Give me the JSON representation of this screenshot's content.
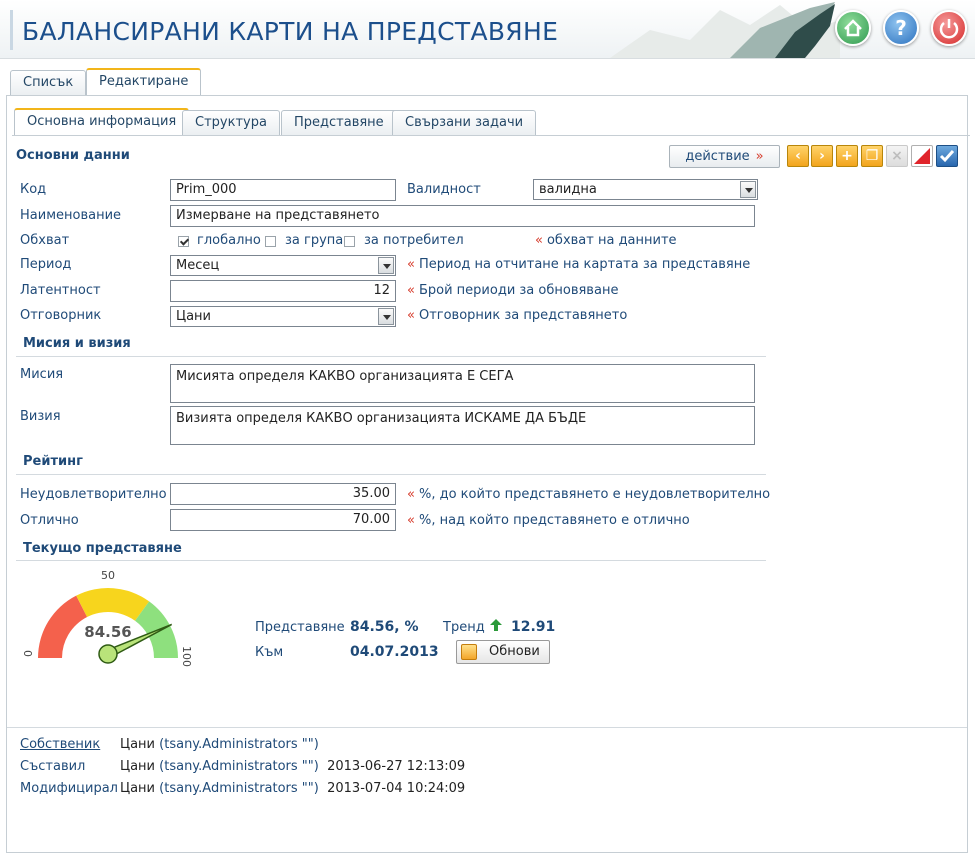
{
  "header": {
    "title": "БАЛАНСИРАНИ КАРТИ НА ПРЕДСТАВЯНЕ"
  },
  "main_tabs": [
    {
      "label": "Списък",
      "active": false
    },
    {
      "label": "Редактиране",
      "active": true
    }
  ],
  "sub_tabs": [
    {
      "label": "Основна информация",
      "active": true
    },
    {
      "label": "Структура",
      "active": false
    },
    {
      "label": "Представяне",
      "active": false
    },
    {
      "label": "Свързани задачи",
      "active": false
    }
  ],
  "toolbar": {
    "action_label": "действие",
    "action_marker": "»"
  },
  "basic": {
    "section_title": "Основни данни",
    "code_label": "Код",
    "code_value": "Prim_000",
    "validity_label": "Валидност",
    "validity_value": "валидна",
    "name_label": "Наименование",
    "name_value": "Измерване на представянето",
    "scope_label": "Обхват",
    "scope_options": [
      {
        "label": "глобално",
        "checked": true
      },
      {
        "label": "за група",
        "checked": false
      },
      {
        "label": "за потребител",
        "checked": false
      }
    ],
    "scope_hint": "обхват на данните",
    "period_label": "Период",
    "period_value": "Месец",
    "period_hint": "Период на отчитане на картата за представяне",
    "latency_label": "Латентност",
    "latency_value": "12",
    "latency_hint": "Брой периоди за обновяване",
    "owner_label": "Отговорник",
    "owner_value": "Цани",
    "owner_hint": "Отговорник за представянето",
    "hint_marker": "«"
  },
  "mission": {
    "section_title": "Мисия и визия",
    "mission_label": "Мисия",
    "mission_value": "Мисията определя КАКВО организацията Е СЕГА",
    "vision_label": "Визия",
    "vision_value": "Визията определя КАКВО организацията ИСКАМЕ ДА БЪДЕ"
  },
  "rating": {
    "section_title": "Рейтинг",
    "poor_label": "Неудовлетворително",
    "poor_value": "35.00",
    "poor_hint": "%, до който представянето е неудовлетворително",
    "excellent_label": "Отлично",
    "excellent_value": "70.00",
    "excellent_hint": "%, над който представянето е отлично"
  },
  "current": {
    "section_title": "Текущо представяне",
    "gauge": {
      "value": 84.56,
      "value_text": "84.56",
      "min_label": "0",
      "mid_label": "50",
      "max_label": "100",
      "zones": [
        {
          "from": 0,
          "to": 35,
          "color": "#f4614c"
        },
        {
          "from": 35,
          "to": 70,
          "color": "#f7d51d"
        },
        {
          "from": 70,
          "to": 100,
          "color": "#8ee07e"
        }
      ]
    },
    "perf_label": "Представяне",
    "perf_value": "84.56, %",
    "trend_label": "Тренд",
    "trend_value": "12.91",
    "date_label": "Към",
    "date_value": "04.07.2013",
    "refresh_label": "Обнови"
  },
  "footer": {
    "owner_label": "Собственик",
    "owner_name": "Цани",
    "owner_user": "(tsany.Administrators \"\")",
    "created_label": "Съставил",
    "created_name": "Цани",
    "created_user": "(tsany.Administrators \"\")",
    "created_at": "2013-06-27 12:13:09",
    "modified_label": "Модифицирал",
    "modified_name": "Цани",
    "modified_user": "(tsany.Administrators \"\")",
    "modified_at": "2013-07-04 10:24:09"
  }
}
